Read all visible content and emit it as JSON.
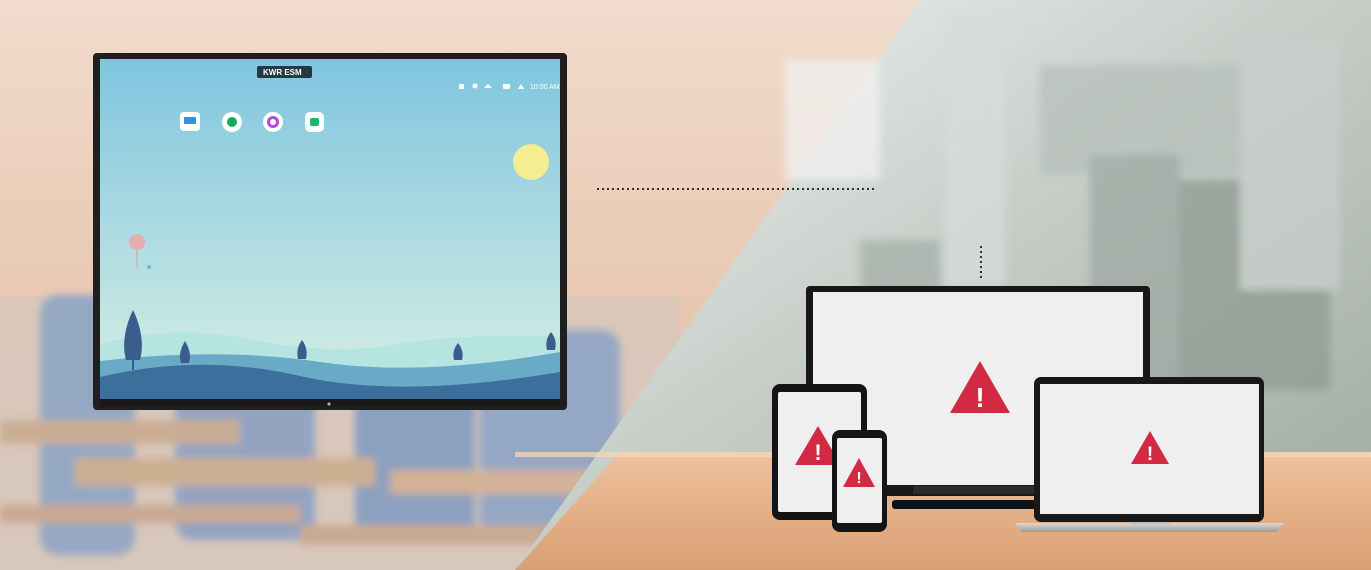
{
  "display": {
    "top_badge": "KWR ESM",
    "status_time": "10:00 AM",
    "status_icons": [
      "cast-icon",
      "bluetooth-icon",
      "wifi-icon",
      "chat-icon",
      "network-icon"
    ],
    "app_icons": [
      "whiteboard-app-icon",
      "record-app-icon",
      "browser-app-icon",
      "store-app-icon"
    ]
  },
  "devices": {
    "alert_symbol": "!",
    "items": [
      "desktop-monitor",
      "tablet",
      "smartphone",
      "laptop"
    ]
  },
  "colors": {
    "alert_red": "#d12a42",
    "screen_sky_top": "#7fc6df",
    "screen_sky_bottom": "#d8efe4",
    "sun": "#f4ee91",
    "desk_wood": "#e9b58b",
    "classroom_wall": "#efcfb9"
  }
}
